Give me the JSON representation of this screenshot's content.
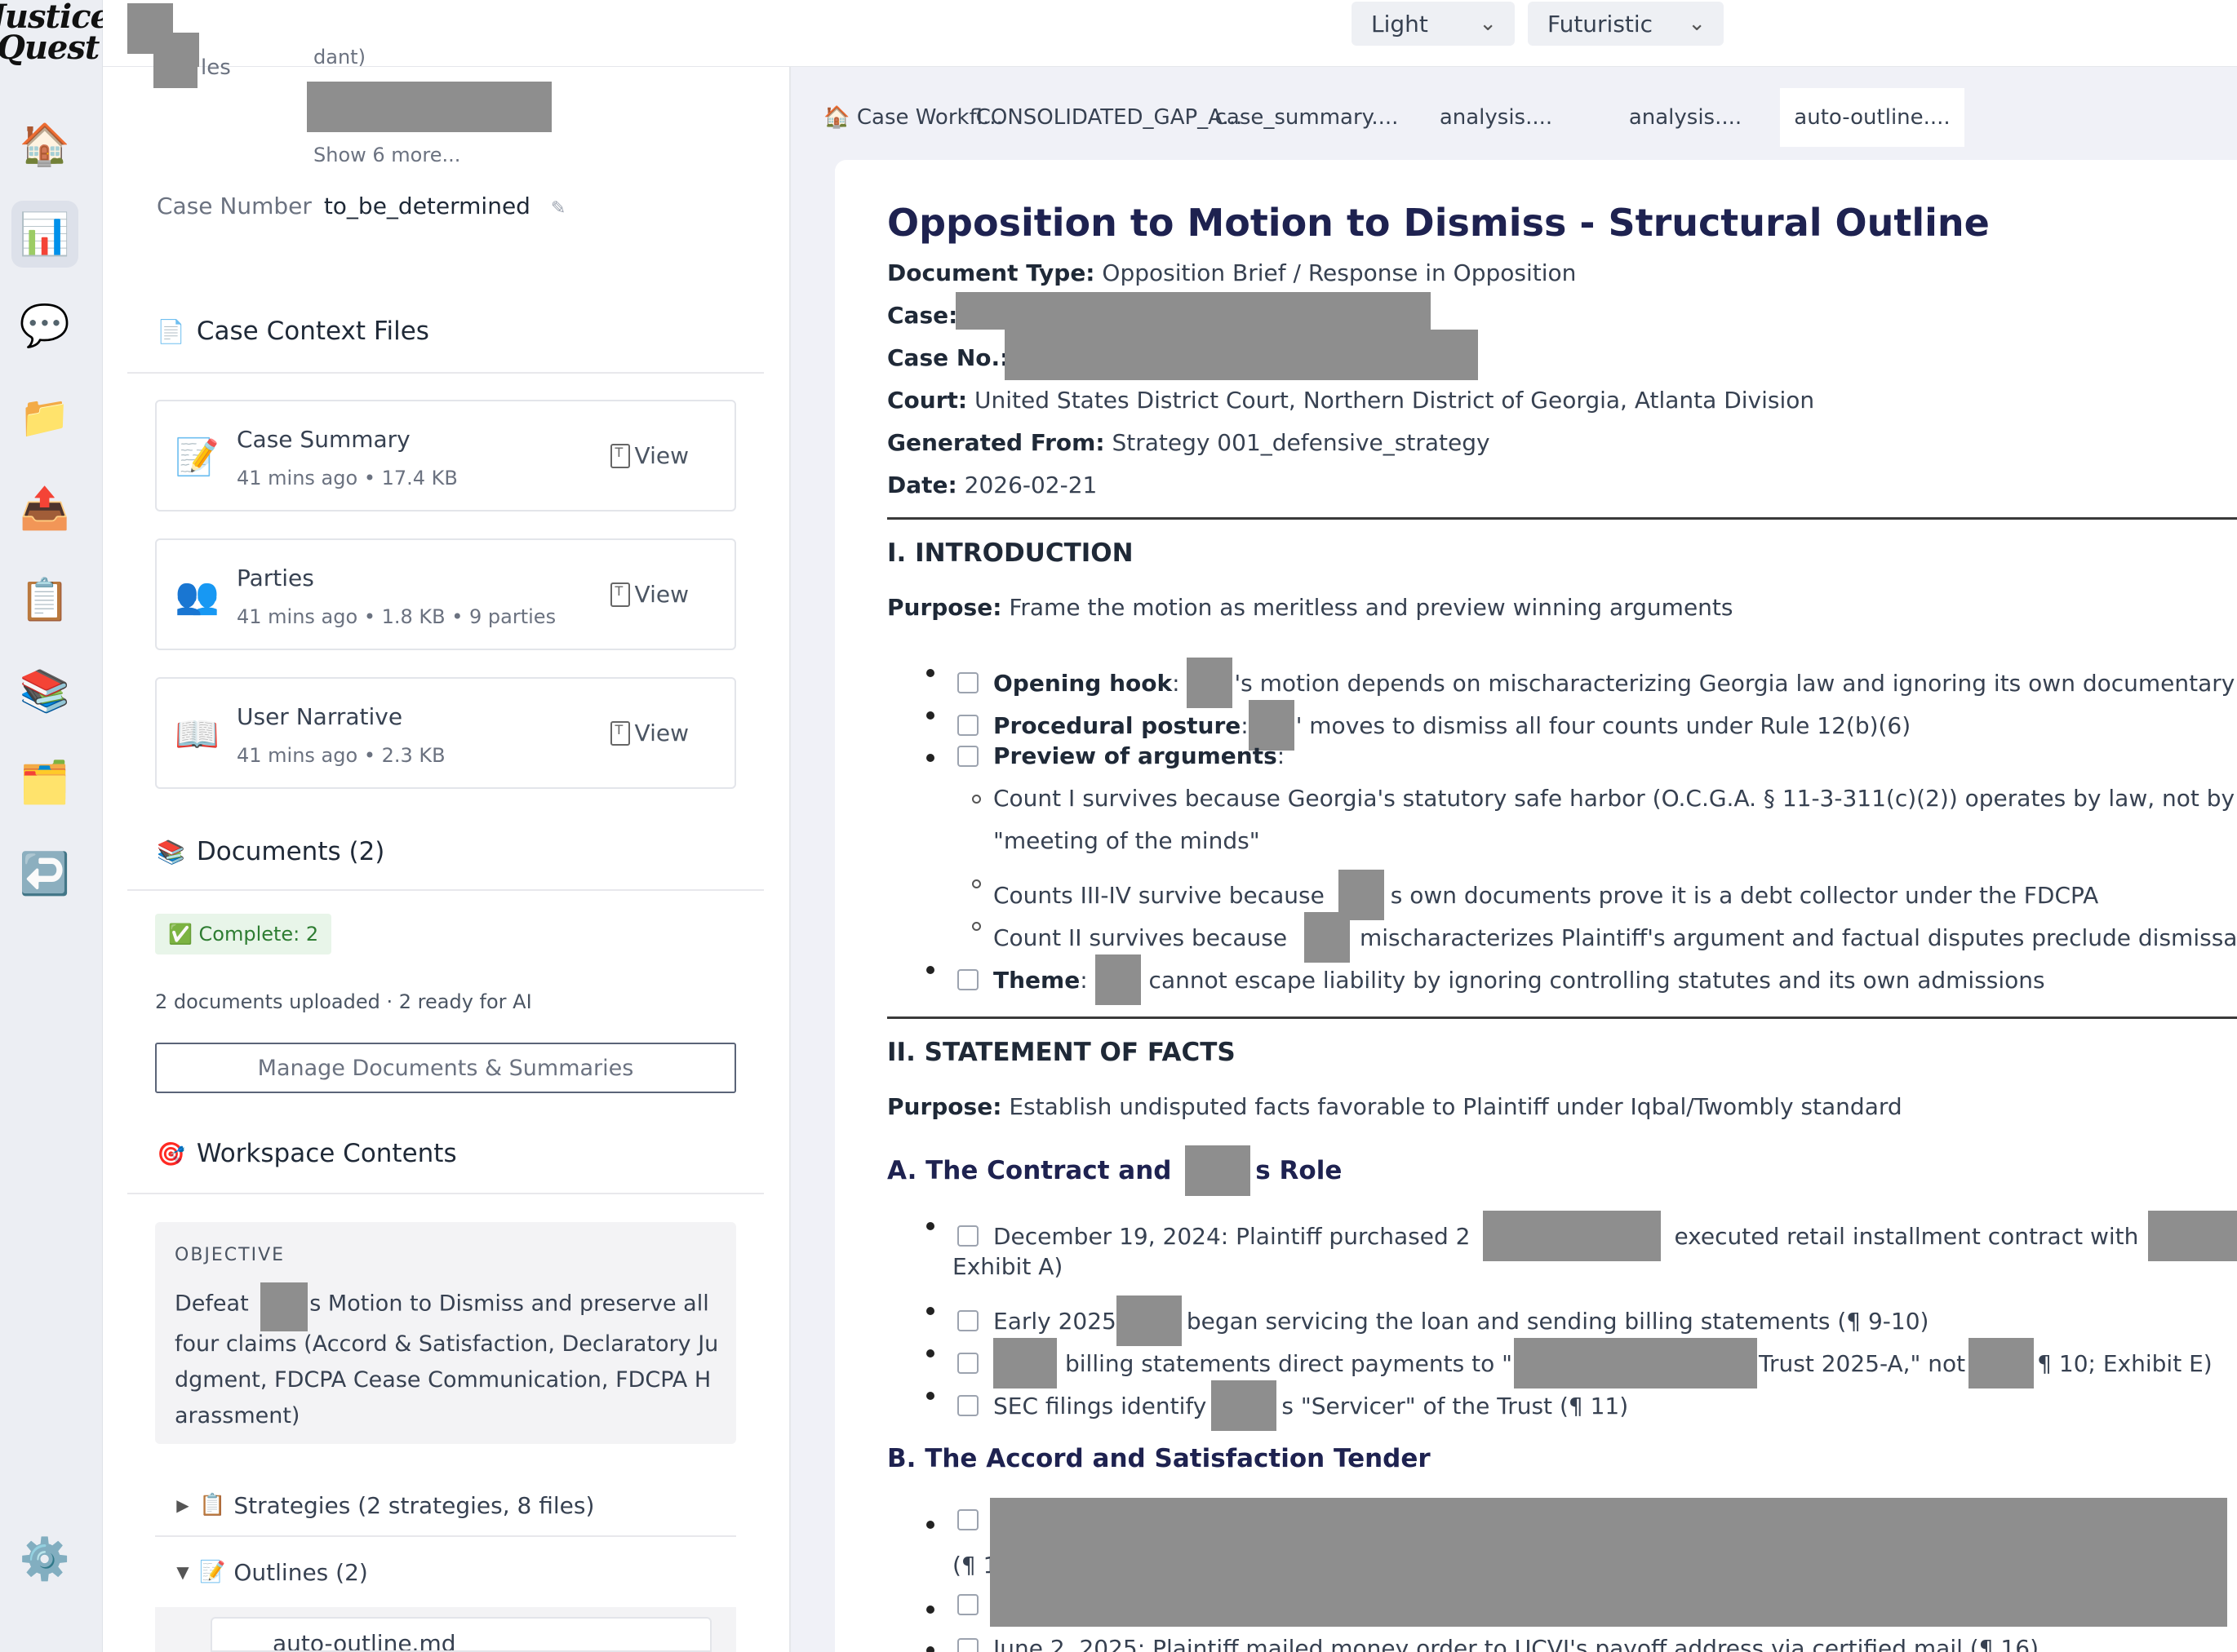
{
  "rail": {
    "logo_line1": "Justice",
    "logo_line2": "Quest",
    "items": [
      {
        "name": "home",
        "glyph": "🏠"
      },
      {
        "name": "analytics",
        "glyph": "📊"
      },
      {
        "name": "chat",
        "glyph": "💬"
      },
      {
        "name": "folder",
        "glyph": "📁"
      },
      {
        "name": "upload",
        "glyph": "📤"
      },
      {
        "name": "clipboard",
        "glyph": "📋"
      },
      {
        "name": "books",
        "glyph": "📚"
      },
      {
        "name": "files",
        "glyph": "🗂️"
      },
      {
        "name": "return",
        "glyph": "↩️"
      },
      {
        "name": "settings",
        "glyph": "⚙️"
      }
    ]
  },
  "topbar": {
    "theme_value": "Light",
    "style_value": "Futuristic"
  },
  "left": {
    "partial_label_1": "les",
    "partial_label_2": "dant)",
    "show_more": "Show 6 more...",
    "case_number_label": "Case Number",
    "case_number_value": "to_be_determined",
    "edit_glyph": "✎",
    "context_files_title": "Case Context Files",
    "context_files_icon": "📄",
    "files": [
      {
        "icon": "📝",
        "name": "Case Summary",
        "meta": "41 mins ago • 17.4 KB",
        "view": "View"
      },
      {
        "icon": "👥",
        "name": "Parties",
        "meta": "41 mins ago • 1.8 KB • 9 parties",
        "view": "View"
      },
      {
        "icon": "📖",
        "name": "User Narrative",
        "meta": "41 mins ago • 2.3 KB",
        "view": "View"
      }
    ],
    "documents_title": "Documents (2)",
    "documents_icon": "📚",
    "complete_badge": "✅ Complete: 2",
    "docs_status": "2 documents uploaded · 2 ready for AI",
    "manage_button": "Manage Documents & Summaries",
    "workspace_title": "Workspace Contents",
    "workspace_icon": "🎯",
    "objective_label": "OBJECTIVE",
    "objective_pre": "Defeat",
    "objective_post": "s Motion to Dismiss and preserve all four claims (Accord & Satisfaction, Declaratory Judgment, FDCPA Cease Communication, FDCPA Harassment)",
    "strategies_label": "Strategies (2 strategies, 8 files)",
    "strategies_icon": "📋",
    "outlines_label": "Outlines (2)",
    "outlines_icon": "📝",
    "outline_file": "auto-outline.md"
  },
  "tabs": [
    {
      "label": "🏠 Case Workfl...",
      "active": false
    },
    {
      "label": "CONSOLIDATED_GAP_A...",
      "active": false
    },
    {
      "label": "case_summary....",
      "active": false
    },
    {
      "label": "analysis....",
      "active": false
    },
    {
      "label": "analysis....",
      "active": false
    },
    {
      "label": "auto-outline....",
      "active": true
    }
  ],
  "doc": {
    "title": "Opposition to Motion to Dismiss - Structural Outline",
    "doc_type_label": "Document Type:",
    "doc_type_value": "Opposition Brief / Response in Opposition",
    "case_label": "Case:",
    "case_no_label": "Case No.:",
    "court_label": "Court:",
    "court_value": "United States District Court, Northern District of Georgia, Atlanta Division",
    "generated_label": "Generated From:",
    "generated_value": "Strategy 001_defensive_strategy",
    "date_label": "Date:",
    "date_value": "2026-02-21",
    "intro_heading": "I. INTRODUCTION",
    "purpose_label": "Purpose:",
    "intro_purpose": "Frame the motion as meritless and preview winning arguments",
    "opening_hook_label": "Opening hook",
    "opening_hook_text": "'s motion depends on mischaracterizing Georgia law and ignoring its own documentary admissio",
    "procedural_label": "Procedural posture",
    "procedural_text": "' moves to dismiss all four counts under Rule 12(b)(6)",
    "preview_label": "Preview of arguments",
    "sub1_line1": "Count I survives because Georgia's statutory safe harbor (O.C.G.A. § 11-3-311(c)(2)) operates by law, not by",
    "sub1_line2": "\"meeting of the minds\"",
    "sub2_pre": "Counts III-IV survive because",
    "sub2_post": "s own documents prove it is a debt collector under the FDCPA",
    "sub3_pre": "Count II survives because",
    "sub3_post": "mischaracterizes Plaintiff's argument and factual disputes preclude dismissal",
    "theme_label": "Theme",
    "theme_text": "cannot escape liability by ignoring controlling statutes and its own admissions",
    "facts_heading": "II. STATEMENT OF FACTS",
    "facts_purpose": "Establish undisputed facts favorable to Plaintiff under Iqbal/Twombly standard",
    "sec_a_pre": "A. The Contract and",
    "sec_a_post": "s Role",
    "fact1_pre": "December 19, 2024: Plaintiff purchased 2",
    "fact1_mid": "executed retail installment contract with",
    "fact1_line2": "Exhibit A)",
    "fact2_pre": "Early 2025",
    "fact2_post": "began servicing the loan and sending billing statements (¶ 9-10)",
    "fact3_pre": "billing statements direct payments to \"",
    "fact3_mid": "Trust 2025-A,\" not",
    "fact3_post": "¶ 10; Exhibit E)",
    "fact4_pre": "SEC filings identify",
    "fact4_post": "s \"Servicer\" of the Trust (¶ 11)",
    "sec_b": "B. The Accord and Satisfaction Tender",
    "b_partial": "(¶ 1",
    "b_cut_line": "June 2, 2025: Plaintiff mailed money order to UCVI's payoff address via certified mail (¶ 16)"
  }
}
